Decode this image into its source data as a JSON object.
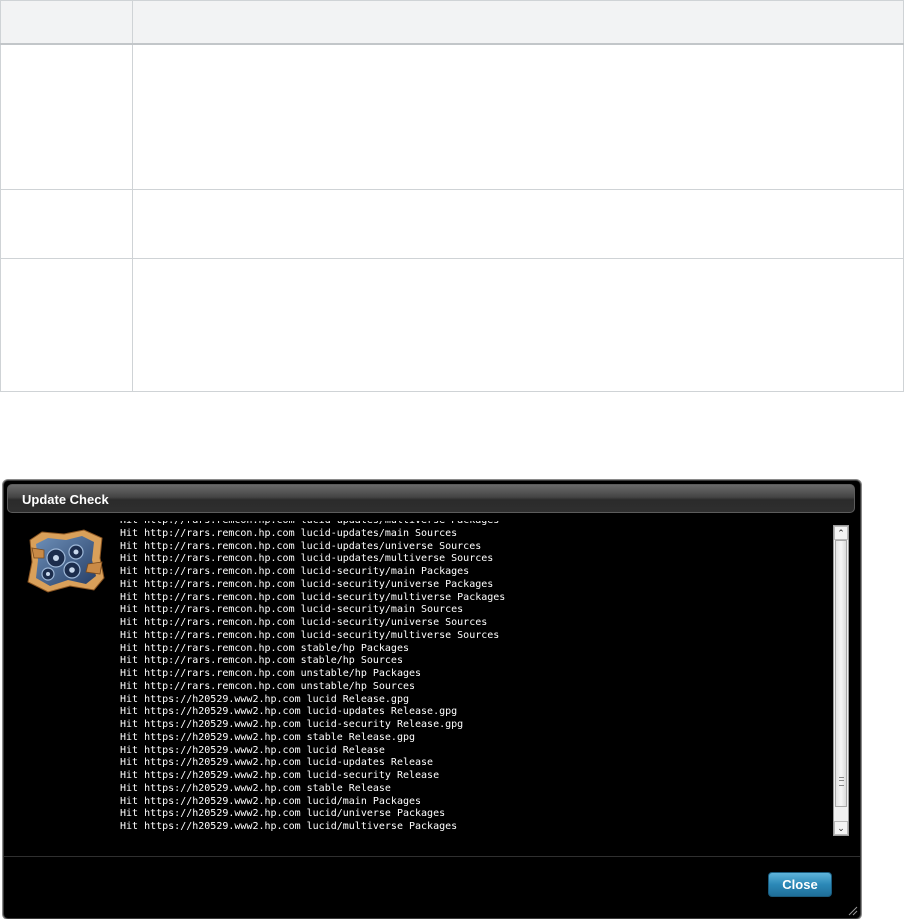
{
  "dialog": {
    "title": "Update Check",
    "close_label": "Close",
    "log_lines": [
      "Hit http://rars.remcon.hp.com lucid-updates/multiverse Packages",
      "Hit http://rars.remcon.hp.com lucid-updates/main Sources",
      "Hit http://rars.remcon.hp.com lucid-updates/universe Sources",
      "Hit http://rars.remcon.hp.com lucid-updates/multiverse Sources",
      "Hit http://rars.remcon.hp.com lucid-security/main Packages",
      "Hit http://rars.remcon.hp.com lucid-security/universe Packages",
      "Hit http://rars.remcon.hp.com lucid-security/multiverse Packages",
      "Hit http://rars.remcon.hp.com lucid-security/main Sources",
      "Hit http://rars.remcon.hp.com lucid-security/universe Sources",
      "Hit http://rars.remcon.hp.com lucid-security/multiverse Sources",
      "Hit http://rars.remcon.hp.com stable/hp Packages",
      "Hit http://rars.remcon.hp.com stable/hp Sources",
      "Hit http://rars.remcon.hp.com unstable/hp Packages",
      "Hit http://rars.remcon.hp.com unstable/hp Sources",
      "Hit https://h20529.www2.hp.com lucid Release.gpg",
      "Hit https://h20529.www2.hp.com lucid-updates Release.gpg",
      "Hit https://h20529.www2.hp.com lucid-security Release.gpg",
      "Hit https://h20529.www2.hp.com stable Release.gpg",
      "Hit https://h20529.www2.hp.com lucid Release",
      "Hit https://h20529.www2.hp.com lucid-updates Release",
      "Hit https://h20529.www2.hp.com lucid-security Release",
      "Hit https://h20529.www2.hp.com stable Release",
      "Hit https://h20529.www2.hp.com lucid/main Packages",
      "Hit https://h20529.www2.hp.com lucid/universe Packages",
      "Hit https://h20529.www2.hp.com lucid/multiverse Packages"
    ]
  },
  "colors": {
    "dialog_bg": "#000000",
    "close_button": "#2b88b7",
    "table_header": "#f2f3f4",
    "table_border": "#cfd3d6"
  },
  "icons": {
    "logo": "thinclient-gears-logo",
    "scroll_up": "chevron-up-icon",
    "scroll_down": "chevron-down-icon",
    "resize": "resize-grip-icon"
  }
}
